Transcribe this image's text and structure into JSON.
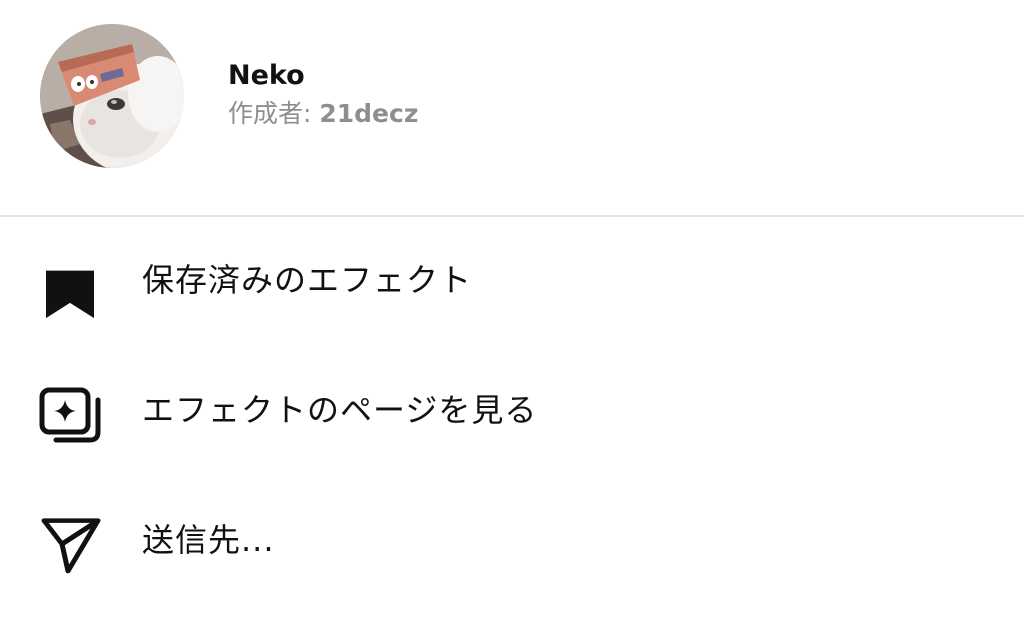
{
  "effect": {
    "name": "Neko",
    "creator_prefix": "作成者: ",
    "creator_name": "21decz",
    "avatar_icon": "cat-photo-avatar"
  },
  "menu": [
    {
      "label": "保存済みのエフェクト",
      "icon": "bookmark-icon"
    },
    {
      "label": "エフェクトのページを見る",
      "icon": "effect-page-icon"
    },
    {
      "label": "送信先...",
      "icon": "send-icon"
    }
  ],
  "colors": {
    "text_primary": "#111111",
    "text_secondary": "#8e8e8e",
    "divider": "#e3e3e3",
    "background": "#ffffff"
  }
}
